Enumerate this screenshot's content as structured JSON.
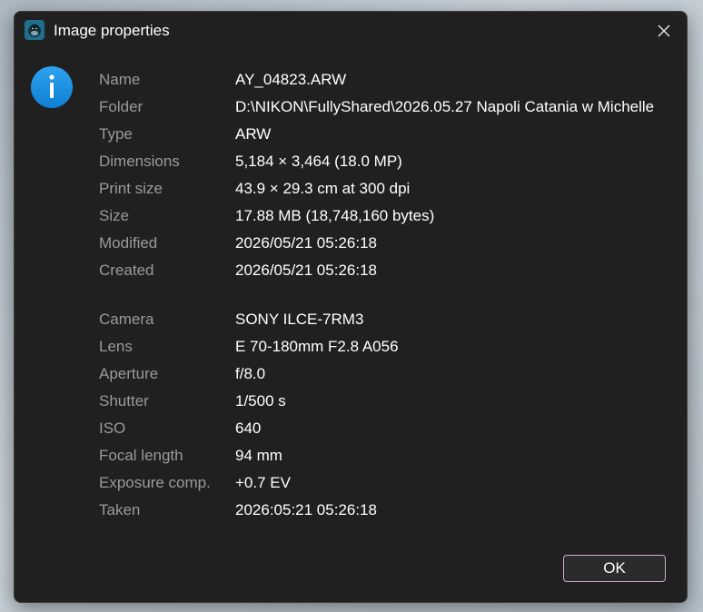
{
  "window": {
    "title": "Image properties",
    "app_icon": "gorilla-app-icon",
    "close_icon": "close-icon"
  },
  "info_icon": "info-icon",
  "accent_color": "#1a8fe0",
  "file_properties": [
    {
      "label": "Name",
      "value": "AY_04823.ARW"
    },
    {
      "label": "Folder",
      "value": "D:\\NIKON\\FullyShared\\2026.05.27 Napoli Catania w Michelle"
    },
    {
      "label": "Type",
      "value": "ARW"
    },
    {
      "label": "Dimensions",
      "value": "5,184 × 3,464 (18.0 MP)"
    },
    {
      "label": "Print size",
      "value": "43.9 × 29.3 cm at 300 dpi"
    },
    {
      "label": "Size",
      "value": "17.88 MB (18,748,160 bytes)"
    },
    {
      "label": "Modified",
      "value": "2026/05/21 05:26:18"
    },
    {
      "label": "Created",
      "value": "2026/05/21 05:26:18"
    }
  ],
  "exif_properties": [
    {
      "label": "Camera",
      "value": "SONY ILCE-7RM3"
    },
    {
      "label": "Lens",
      "value": "E 70-180mm F2.8 A056"
    },
    {
      "label": "Aperture",
      "value": "f/8.0"
    },
    {
      "label": "Shutter",
      "value": "1/500 s"
    },
    {
      "label": "ISO",
      "value": "640"
    },
    {
      "label": "Focal length",
      "value": "94 mm"
    },
    {
      "label": "Exposure comp.",
      "value": "+0.7 EV"
    },
    {
      "label": "Taken",
      "value": "2026:05:21 05:26:18"
    }
  ],
  "buttons": {
    "ok_label": "OK"
  }
}
